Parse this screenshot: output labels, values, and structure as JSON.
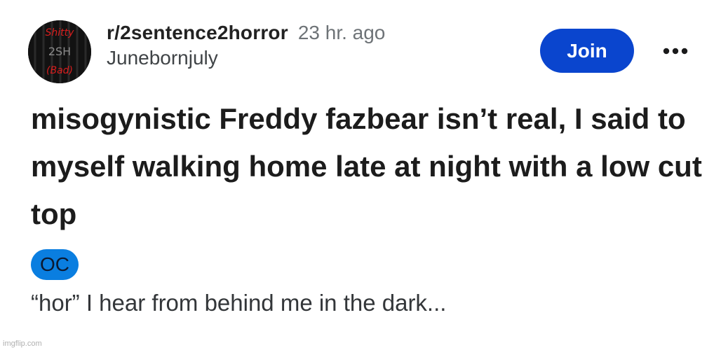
{
  "header": {
    "avatar_icon": "subreddit-avatar-icon",
    "avatar_text": [
      "Shitty",
      "2SH",
      "(Bad)"
    ],
    "subreddit": "r/2sentence2horror",
    "time": "23 hr. ago",
    "username": "Junebornjuly",
    "join_label": "Join",
    "more_icon": "more-options-icon"
  },
  "post": {
    "title": "misogynistic Freddy fazbear isn’t real, I said to myself walking home late at night with a low cut top",
    "flair": "OC",
    "body": "“hor” I hear from behind me in the dark..."
  },
  "watermark": "imgflip.com",
  "colors": {
    "join_bg": "#0a45ce",
    "flair_bg": "#0a7ee0",
    "avatar_bg": "#111111",
    "avatar_text": "#d81e1e"
  }
}
